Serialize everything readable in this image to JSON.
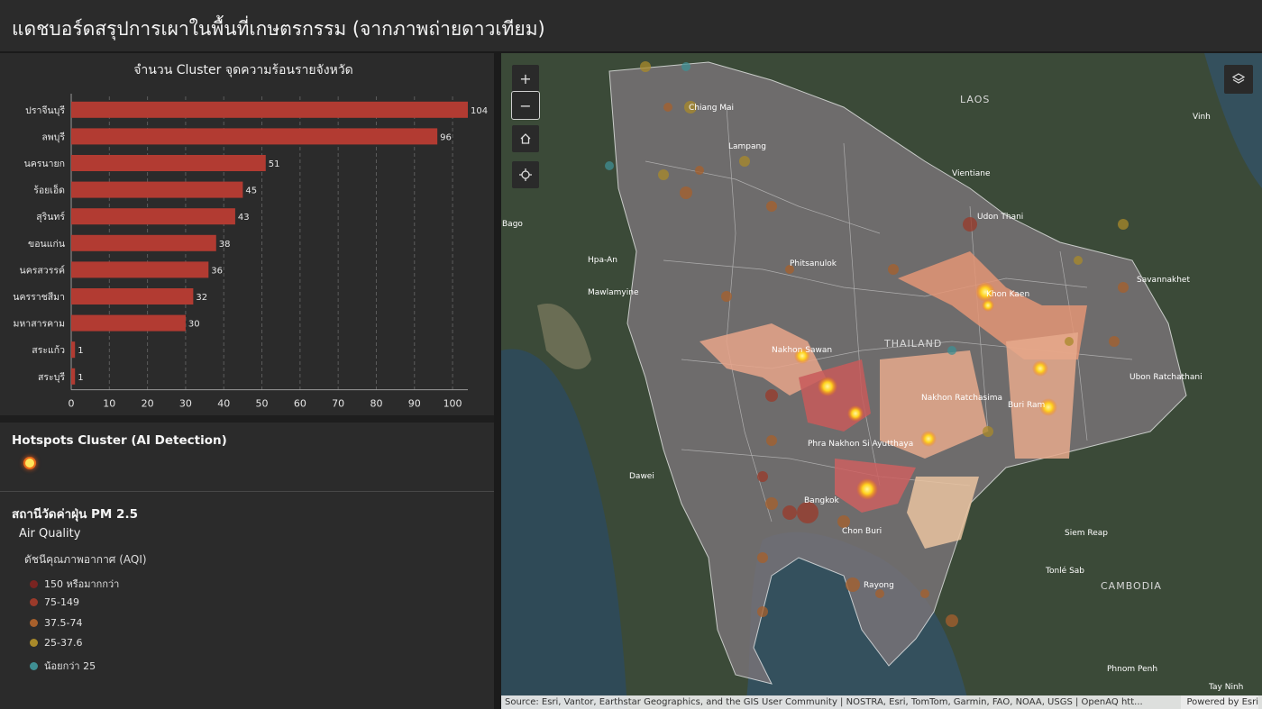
{
  "header": {
    "title": "แดชบอร์ดสรุปการเผาในพื้นที่เกษตรกรรม (จากภาพถ่ายดาวเทียม)"
  },
  "chart_data": {
    "type": "bar",
    "orientation": "horizontal",
    "title": "จำนวน Cluster จุดความร้อนรายจังหวัด",
    "categories": [
      "ปราจีนบุรี",
      "ลพบุรี",
      "นครนายก",
      "ร้อยเอ็ด",
      "สุรินทร์",
      "ขอนแก่น",
      "นครสวรรค์",
      "นครราชสีมา",
      "มหาสารคาม",
      "สระแก้ว",
      "สระบุรี"
    ],
    "values": [
      104,
      96,
      51,
      45,
      43,
      38,
      36,
      32,
      30,
      1,
      1
    ],
    "xticks": [
      0,
      10,
      20,
      30,
      40,
      50,
      60,
      70,
      80,
      90,
      100
    ],
    "xlim": [
      0,
      104
    ],
    "bar_color": "#b23b32",
    "grid": "vertical dashed"
  },
  "legend": {
    "hotspots_title": "Hotspots Cluster (AI Detection)",
    "pm_title": "สถานีวัดค่าฝุ่น PM 2.5",
    "air_quality": "Air Quality",
    "aqi_title": "ดัชนีคุณภาพอากาศ (AQI)",
    "aqi_items": [
      {
        "label": "150 หรือมากกว่า",
        "color": "#7a2421"
      },
      {
        "label": "75-149",
        "color": "#9a3a2a"
      },
      {
        "label": "37.5-74",
        "color": "#a7602c"
      },
      {
        "label": "25-37.6",
        "color": "#a98a2a"
      },
      {
        "label": "น้อยกว่า 25",
        "color": "#3f8f93"
      }
    ]
  },
  "map": {
    "zoom_in": "+",
    "zoom_out": "−",
    "countries": [
      "LAOS",
      "THAILAND",
      "CAMBODIA"
    ],
    "cities": [
      "Chiang Mai",
      "Lampang",
      "Vientiane",
      "Udon Thani",
      "Vinh",
      "Bago",
      "Hpa-An",
      "Mawlamyine",
      "Phitsanulok",
      "Nakhon Sawan",
      "Khon Kaen",
      "Savannakhet",
      "Ubon Ratchathani",
      "Nakhon Ratchasima",
      "Buri Ram",
      "Phra Nakhon Si Ayutthaya",
      "Dawei",
      "Bangkok",
      "Chon Buri",
      "Rayong",
      "Siem Reap",
      "Tonlé Sab",
      "Phnom Penh",
      "Tay Ninh"
    ],
    "attribution": "Source: Esri, Vantor, Earthstar Geographics, and the GIS User Community | NOSTRA, Esri, TomTom, Garmin, FAO, NOAA, USGS | OpenAQ htt...",
    "powered_by": "Powered by Esri"
  }
}
